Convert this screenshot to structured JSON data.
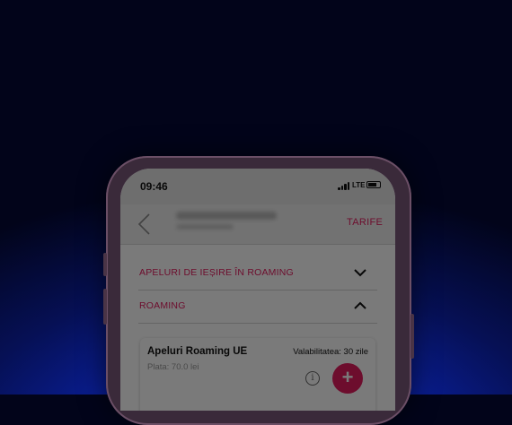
{
  "status_bar": {
    "time": "09:46",
    "network": "LTE"
  },
  "header": {
    "action_label": "TARIFE"
  },
  "sections": [
    {
      "label": "APELURI DE IEȘIRE ÎN ROAMING",
      "expanded": false,
      "chevron": "chevron-down-icon"
    },
    {
      "label": "ROAMING",
      "expanded": true,
      "chevron": "chevron-up-icon"
    }
  ],
  "offer_card": {
    "title": "Apeluri Roaming UE",
    "price": "Plata: 70.0 lei",
    "validity": "Valabilitatea: 30 zile",
    "info_icon": "i",
    "add_icon": "+"
  },
  "colors": {
    "accent": "#e31c5f",
    "background_blue": "#0a1f9a"
  }
}
